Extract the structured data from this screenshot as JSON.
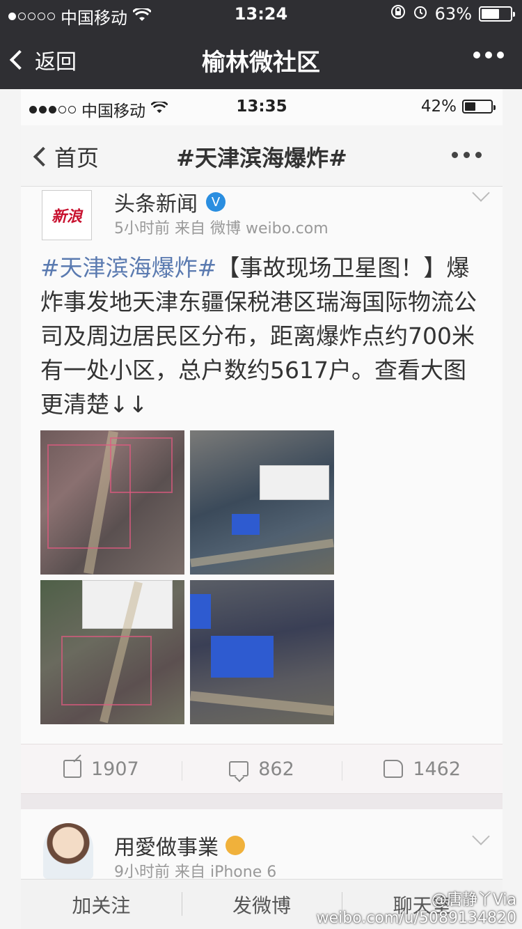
{
  "outer_status": {
    "carrier": "中国移动",
    "time": "13:24",
    "battery": "63%",
    "battery_level": 0.63
  },
  "outer_nav": {
    "back_label": "返回",
    "title": "榆林微社区"
  },
  "inner_status": {
    "carrier": "中国移动",
    "time": "13:35",
    "battery": "42%",
    "battery_level": 0.42
  },
  "inner_nav": {
    "back_label": "首页",
    "title": "#天津滨海爆炸#"
  },
  "post": {
    "avatar_text": "新浪",
    "author": "头条新闻",
    "meta": "5小时前  来自 微博 weibo.com",
    "hashtag": "#天津滨海爆炸#",
    "text": "【事故现场卫星图！】爆炸事发地天津东疆保税港区瑞海国际物流公司及周边居民区分布，距离爆炸点约700米有一处小区，总户数约5617户。查看大图更清楚↓↓"
  },
  "actions": {
    "reposts": "1907",
    "comments": "862",
    "likes": "1462"
  },
  "post2": {
    "author": "用愛做事業",
    "meta": "9小时前  来自 iPhone 6"
  },
  "tabbar": {
    "follow": "加关注",
    "post": "发微博",
    "chat": "聊天室"
  },
  "watermark": {
    "line1": "@唐静丫Via",
    "line2": "weibo.com/u/5089134820"
  },
  "icons": {
    "wifi": "wifi-icon",
    "alarm": "alarm-icon",
    "lock": "rotation-lock-icon",
    "verified": "verified-badge-icon"
  }
}
